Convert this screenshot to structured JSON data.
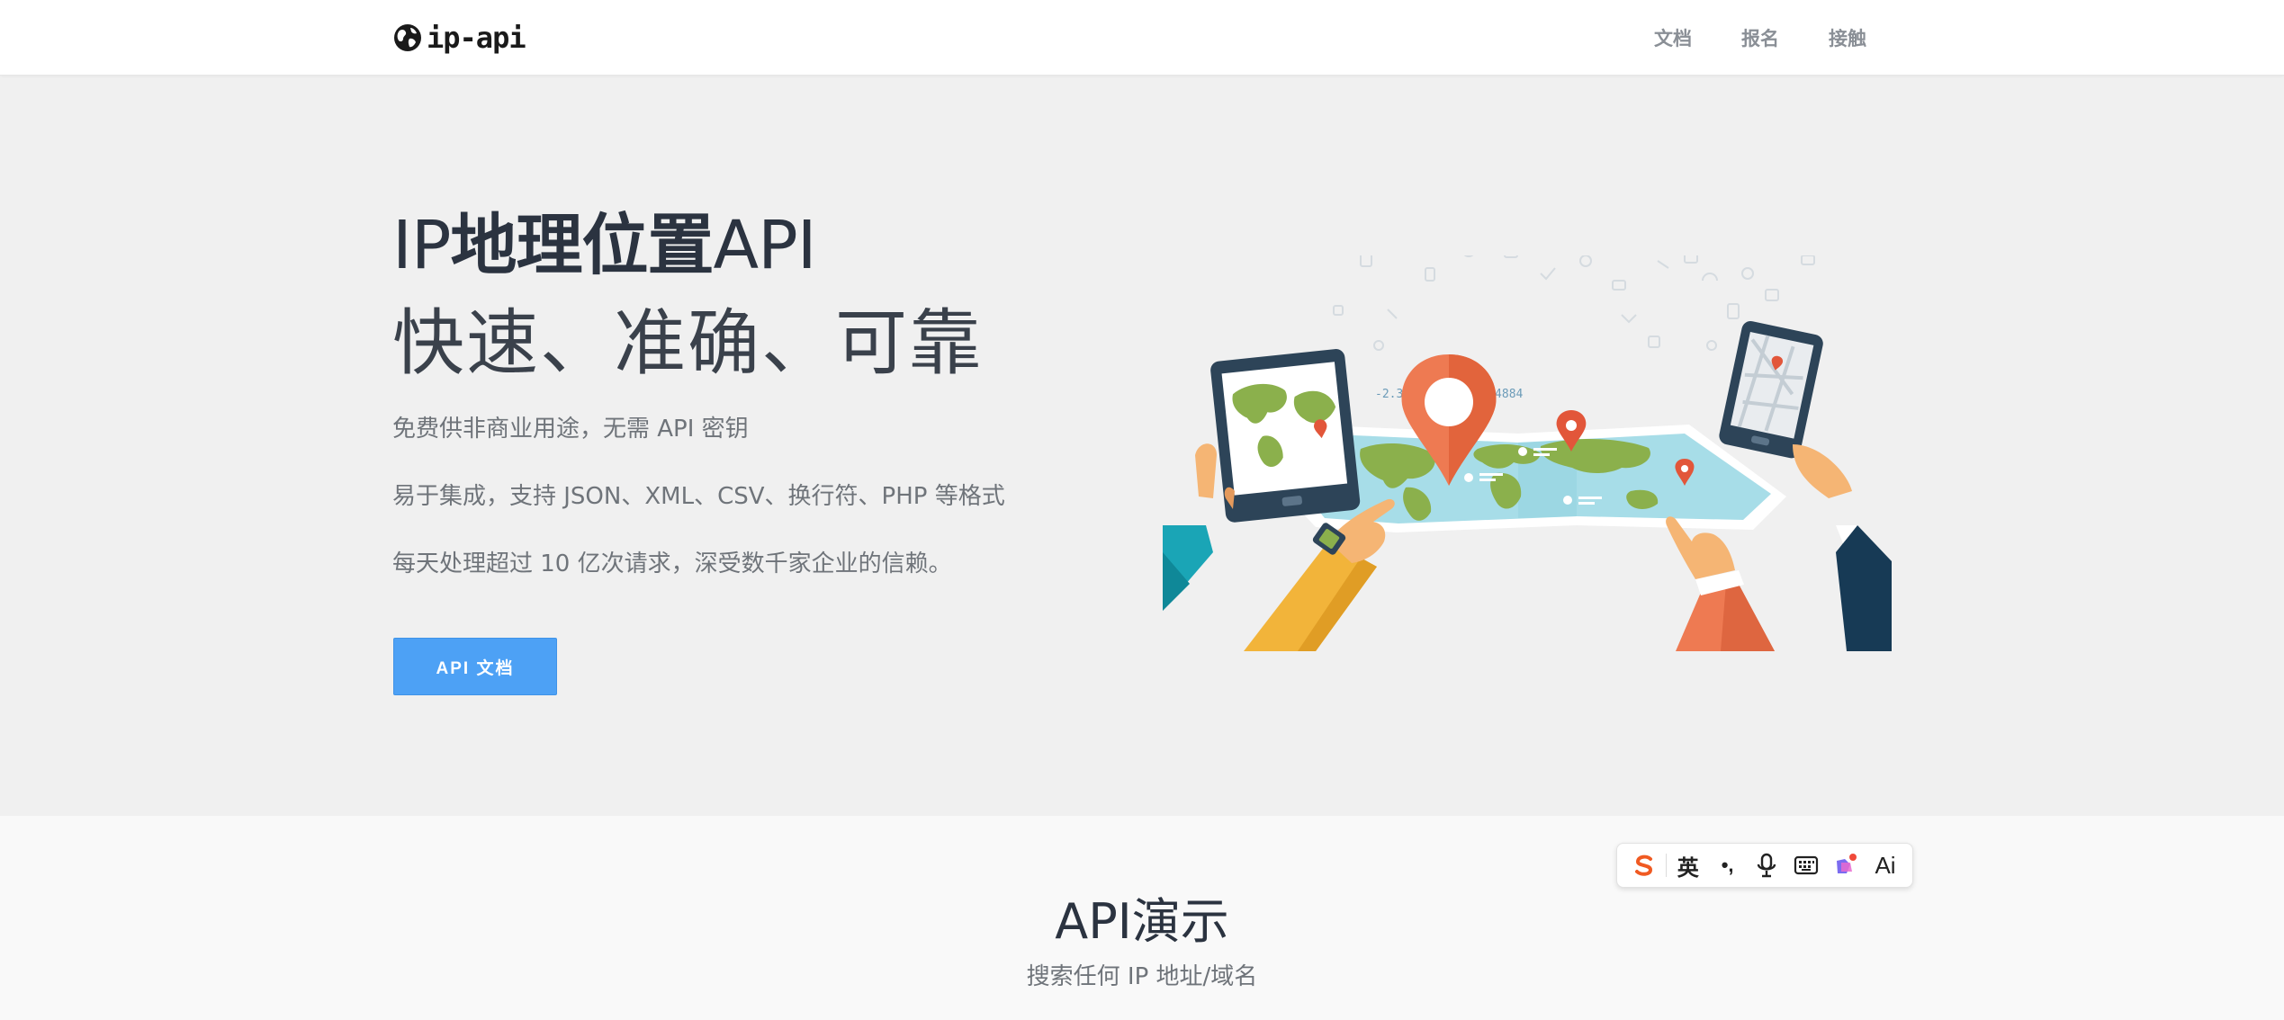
{
  "brand": {
    "name": "ip-api",
    "logo_icon": "globe-icon"
  },
  "nav": {
    "items": [
      {
        "label": "文档"
      },
      {
        "label": "报名"
      },
      {
        "label": "接触"
      }
    ]
  },
  "hero": {
    "title_prefix": "IP",
    "title_bold": "地理位置",
    "title_suffix": "API",
    "subtitle": "快速、准确、可靠",
    "lines": [
      "免费供非商业用途，无需 API 密钥",
      "易于集成，支持 JSON、XML、CSV、换行符、PHP 等格式",
      "每天处理超过 10 亿次请求，深受数千家企业的信赖。"
    ],
    "button_label": "API 文档",
    "illustration": {
      "coordinates_label": "-2.329799, -52.014884",
      "icon": "world-map-illustration"
    }
  },
  "demo": {
    "title": "API演示",
    "subtitle": "搜索任何 IP 地址/域名"
  },
  "ime_toolbar": {
    "items": [
      {
        "icon": "sogou-logo-icon",
        "label": ""
      },
      {
        "icon": "language-icon",
        "label": "英"
      },
      {
        "icon": "punctuation-icon",
        "label": "•,"
      },
      {
        "icon": "microphone-icon",
        "label": ""
      },
      {
        "icon": "keyboard-icon",
        "label": ""
      },
      {
        "icon": "skin-icon",
        "label": ""
      },
      {
        "icon": "ai-icon",
        "label": "Ai"
      }
    ]
  },
  "colors": {
    "primary_button": "#4da1f5",
    "hero_bg": "#f0f0f0",
    "demo_bg": "#f9f9f9",
    "sogou_orange": "#f05a22"
  }
}
